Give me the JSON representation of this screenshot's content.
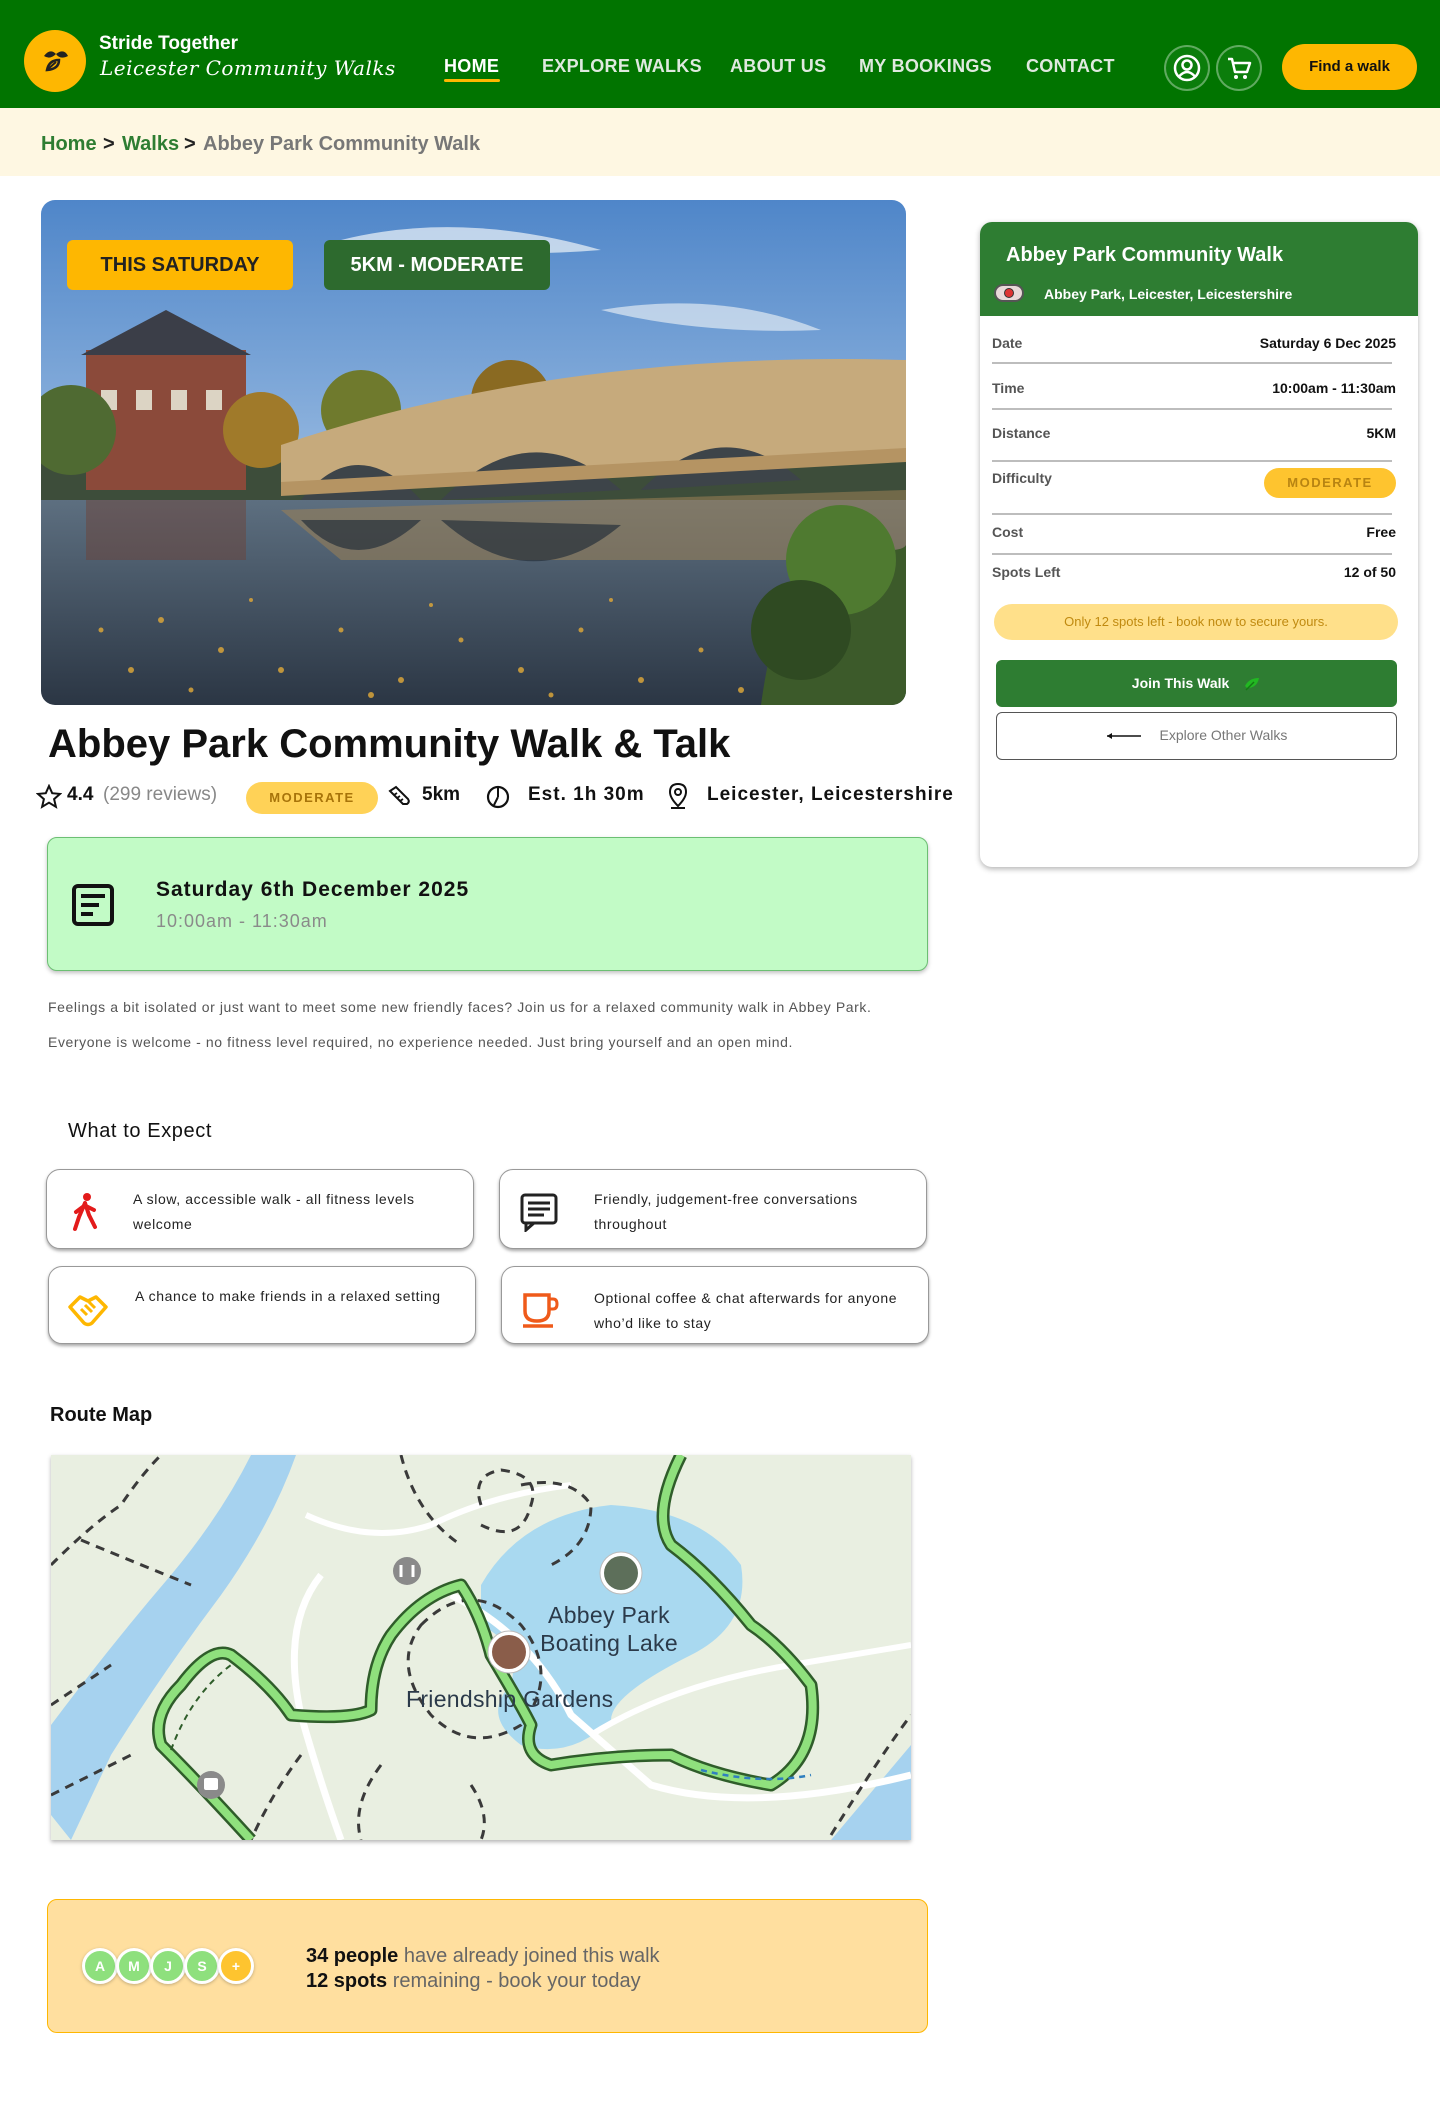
{
  "brand": {
    "title": "Stride Together",
    "subtitle": "Leicester Community Walks"
  },
  "nav": [
    "HOME",
    "EXPLORE WALKS",
    "ABOUT US",
    "MY BOOKINGS",
    "CONTACT"
  ],
  "header_cta": "Find a walk",
  "breadcrumb": {
    "home": "Home",
    "sep1": ">",
    "walks": "Walks",
    "sep2": ">",
    "current": "Abbey Park Community Walk"
  },
  "hero": {
    "tag_day": "THIS SATURDAY",
    "tag_level": "5KM - MODERATE"
  },
  "walk": {
    "title": "Abbey Park Community Walk & Talk",
    "rating": "4.4",
    "reviews": "(299 reviews)",
    "difficulty": "MODERATE",
    "distance": "5km",
    "duration": "Est. 1h 30m",
    "location": "Leicester, Leicestershire"
  },
  "date_box": {
    "date": "Saturday 6th December 2025",
    "time": "10:00am - 11:30am"
  },
  "description": "Feelings a bit isolated or just want to meet some new friendly faces? Join us for a relaxed community walk in Abbey Park. Everyone is welcome - no fitness level required, no experience needed. Just bring yourself and an open mind.",
  "expect": {
    "heading": "What to Expect",
    "items": [
      {
        "icon": "walking-person-icon",
        "text": "A slow, accessible walk - all fitness levels welcome"
      },
      {
        "icon": "chat-icon",
        "text": "Friendly, judgement-free conversations throughout"
      },
      {
        "icon": "handshake-icon",
        "text": "A chance to make friends in a relaxed setting"
      },
      {
        "icon": "coffee-cup-icon",
        "text": "Optional coffee & chat afterwards for anyone who’d like to stay"
      }
    ]
  },
  "route": {
    "heading": "Route Map",
    "labels": {
      "lake_line1": "Abbey Park",
      "lake_line2": "Boating Lake",
      "gardens": "Friendship Gardens"
    }
  },
  "joined": {
    "avatars": [
      "A",
      "M",
      "J",
      "S",
      "+"
    ],
    "count": "34 people",
    "count_text": " have already joined this walk",
    "spots": "12 spots",
    "spots_text": " remaining - book your today"
  },
  "sidebar": {
    "title": "Abbey Park Community Walk",
    "location": "Abbey Park, Leicester, Leicestershire",
    "rows": [
      {
        "label": "Date",
        "value": "Saturday 6 Dec 2025"
      },
      {
        "label": "Time",
        "value": "10:00am - 11:30am"
      },
      {
        "label": "Distance",
        "value": "5KM"
      },
      {
        "label": "Difficulty",
        "value": "MODERATE"
      },
      {
        "label": "Cost",
        "value": "Free"
      },
      {
        "label": "Spots Left",
        "value": "12 of 50"
      }
    ],
    "warning": "Only 12 spots left - book now to secure yours.",
    "join_label": "Join This Walk",
    "explore_label": "Explore Other Walks"
  },
  "colors": {
    "primary_green": "#017400",
    "accent_yellow": "#FEB701",
    "date_box": "#C2FBC6",
    "crumb_bg": "#FEF7E2"
  }
}
